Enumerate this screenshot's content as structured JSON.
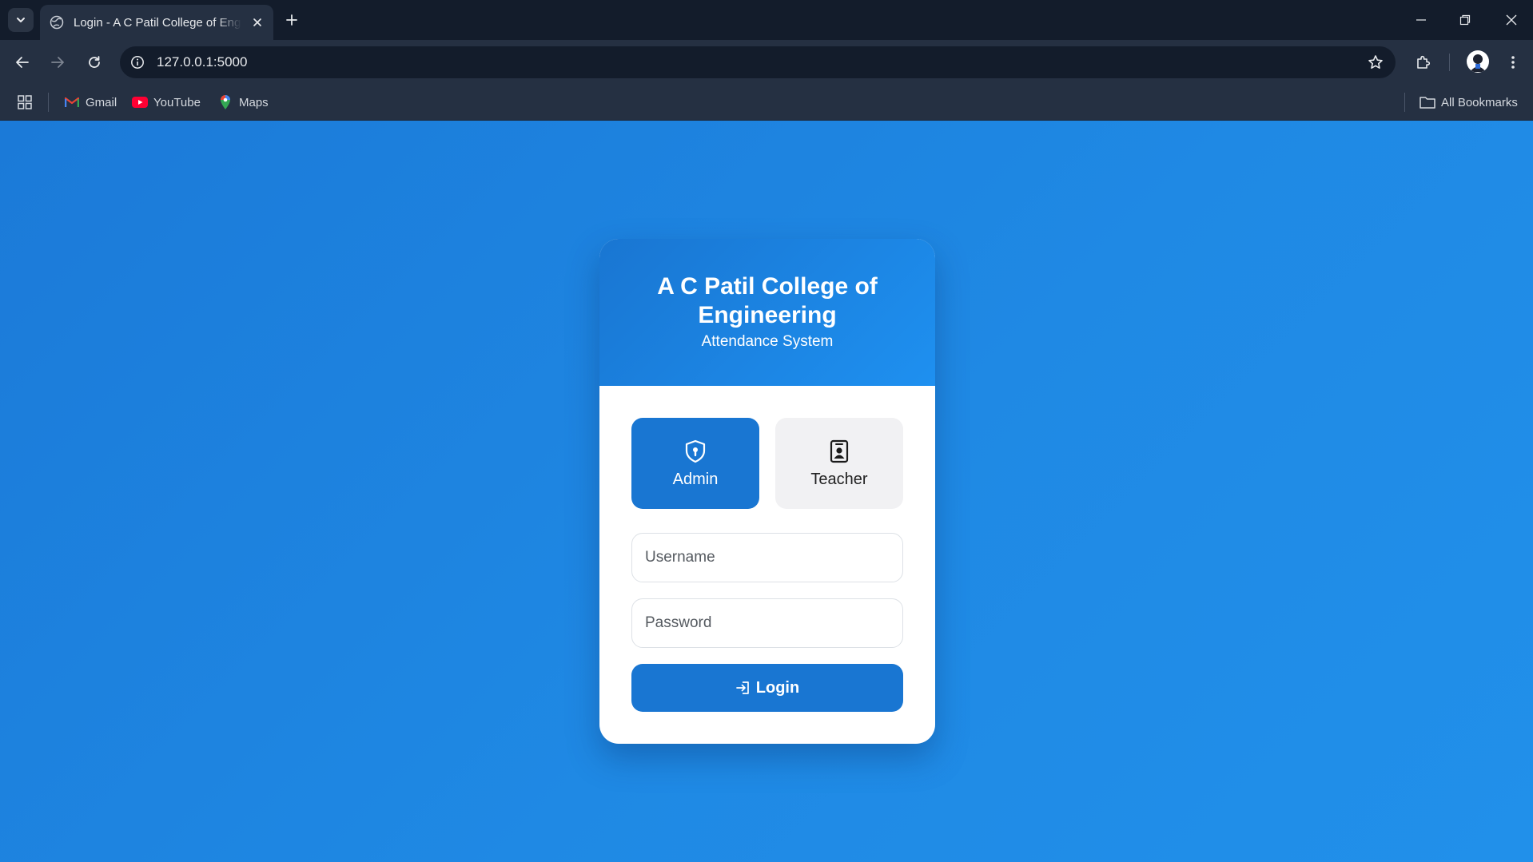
{
  "browser": {
    "tab_title": "Login - A C Patil College of Engineering",
    "url": "127.0.0.1:5000",
    "bookmarks": [
      {
        "label": "Gmail",
        "icon": "gmail-icon"
      },
      {
        "label": "YouTube",
        "icon": "youtube-icon"
      },
      {
        "label": "Maps",
        "icon": "maps-icon"
      }
    ],
    "all_bookmarks_label": "All Bookmarks"
  },
  "login": {
    "college_name": "A C Patil College of Engineering",
    "subtitle": "Attendance System",
    "roles": [
      {
        "label": "Admin",
        "icon": "shield-icon",
        "selected": true
      },
      {
        "label": "Teacher",
        "icon": "id-badge-icon",
        "selected": false
      }
    ],
    "username_placeholder": "Username",
    "password_placeholder": "Password",
    "login_label": "Login"
  },
  "colors": {
    "accent": "#1976d2",
    "page_background": "#1e88e5",
    "browser_chrome": "#253042"
  }
}
